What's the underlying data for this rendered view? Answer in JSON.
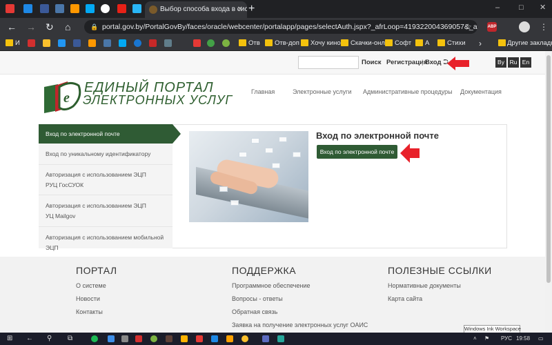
{
  "browser": {
    "tab_title": "Выбор способа входа в сист",
    "new_tab": "+",
    "url": "portal.gov.by/PortalGovBy/faces/oracle/webcenter/portalapp/pages/selectAuth.jspx?_afrLoop=41932200436905​7&_afrWindowM...",
    "extension_label": "ABP",
    "window_controls": [
      "–",
      "□",
      "✕"
    ],
    "bookmarks": [
      {
        "label": "И",
        "type": "icon",
        "color": "#e53935"
      },
      {
        "label": "",
        "type": "icon",
        "color": "#d32f2f"
      },
      {
        "label": "",
        "type": "icon",
        "color": "#fbc02d"
      },
      {
        "label": "",
        "type": "icon",
        "color": "#2196f3"
      },
      {
        "label": "",
        "type": "icon",
        "color": "#3b5998"
      },
      {
        "label": "",
        "type": "icon",
        "color": "#ff9800"
      },
      {
        "label": "",
        "type": "icon",
        "color": "#4a76a8"
      },
      {
        "label": "",
        "type": "icon",
        "color": "#03a9f4"
      },
      {
        "label": "",
        "type": "icon",
        "color": "#1976d2"
      },
      {
        "label": "",
        "type": "icon",
        "color": "#c62828"
      },
      {
        "label": "",
        "type": "icon",
        "color": "#607d8b"
      },
      {
        "label": "",
        "type": "icon",
        "color": "#e53935"
      },
      {
        "label": "",
        "type": "icon",
        "color": "#43a047"
      },
      {
        "label": "",
        "type": "icon",
        "color": "#7cb342"
      },
      {
        "label": "Отв",
        "type": "folder"
      },
      {
        "label": "Отв-доп",
        "type": "folder"
      },
      {
        "label": "Хочу кино",
        "type": "folder"
      },
      {
        "label": "Скачки-онл",
        "type": "folder"
      },
      {
        "label": "Софт",
        "type": "folder"
      },
      {
        "label": "А",
        "type": "folder"
      },
      {
        "label": "Стихи",
        "type": "folder"
      }
    ],
    "bookmarks_more": "›",
    "other_bookmarks": "Другие закладки"
  },
  "topbar": {
    "search_button": "Поиск",
    "register": "Регистрация",
    "separator": "|",
    "login": "Вход",
    "login_icon": "⮊",
    "languages": [
      "By",
      "Ru",
      "En"
    ]
  },
  "header": {
    "logo_line1": "ЕДИНЫЙ ПОРТАЛ",
    "logo_line2": "ЭЛЕКТРОННЫХ УСЛУГ",
    "nav": [
      "Главная",
      "Электронные услуги",
      "Административные процедуры",
      "Документация"
    ]
  },
  "sidebar": {
    "active": "Вход по электронной почте",
    "items": [
      {
        "line1": "Вход по уникальному идентификатору",
        "line2": ""
      },
      {
        "line1": "Авторизация с использованием ЭЦП",
        "line2": "РУЦ ГосСУОК"
      },
      {
        "line1": "Авторизация с использованием ЭЦП",
        "line2": "УЦ Mailgov"
      },
      {
        "line1": "Авторизация с использованием мобильной ЭЦП",
        "line2": ""
      }
    ]
  },
  "content": {
    "title": "Вход по электронной почте",
    "button": "Вход по электронной почте"
  },
  "footer": {
    "portal": {
      "title": "ПОРТАЛ",
      "links": [
        "О системе",
        "Новости",
        "Контакты"
      ]
    },
    "support": {
      "title": "ПОДДЕРЖКА",
      "links": [
        "Программное обеспечение",
        "Вопросы - ответы",
        "Обратная связь",
        "Заявка на получение электронных услуг ОАИС"
      ]
    },
    "useful": {
      "title": "ПОЛЕЗНЫЕ ССЫЛКИ",
      "links": [
        "Нормативные документы",
        "Карта сайта"
      ]
    }
  },
  "tooltip": "Windows Ink Workspace",
  "taskbar": {
    "lang": "РУС",
    "time": "19:58"
  },
  "colors": {
    "brand_green": "#2f5b34",
    "arrow_red": "#e8212a"
  }
}
